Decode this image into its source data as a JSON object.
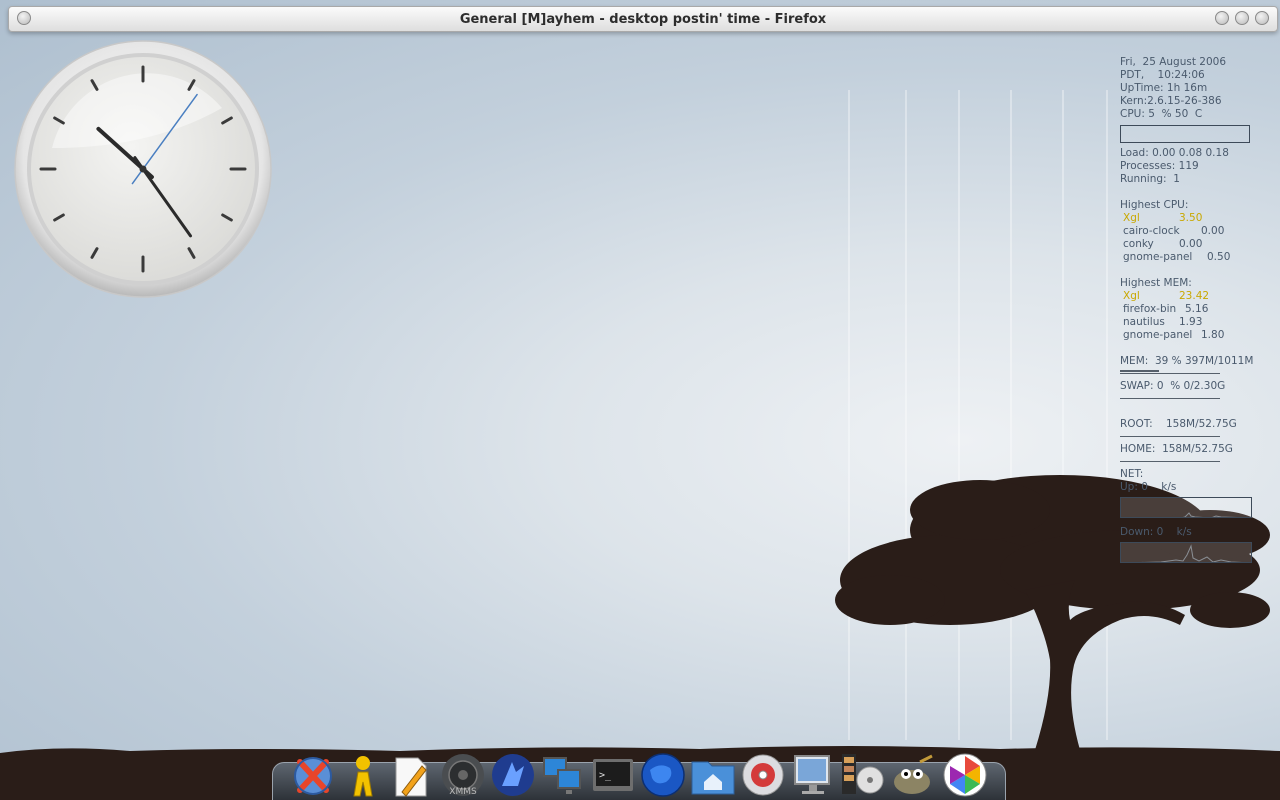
{
  "window": {
    "title": "General [M]ayhem - desktop postin' time - Firefox"
  },
  "conky": {
    "date": "Fri,  25 August 2006",
    "time": "PDT,    10:24:06",
    "uptime": "UpTime: 1h 16m",
    "kern": "Kern:2.6.15-26-386",
    "cpu": "CPU: 5  % 50  C",
    "load": "Load: 0.00 0.08 0.18",
    "processes": "Processes: 119",
    "running": "Running:  1",
    "highest_cpu_label": "Highest CPU:",
    "highest_cpu": [
      {
        "name": "Xgl",
        "value": "3.50"
      },
      {
        "name": "cairo-clock",
        "value": "0.00"
      },
      {
        "name": "conky",
        "value": "0.00"
      },
      {
        "name": "gnome-panel",
        "value": "0.50"
      }
    ],
    "highest_mem_label": "Highest MEM:",
    "highest_mem": [
      {
        "name": "Xgl",
        "value": "23.42"
      },
      {
        "name": "firefox-bin",
        "value": "5.16"
      },
      {
        "name": "nautilus",
        "value": "1.93"
      },
      {
        "name": "gnome-panel",
        "value": "1.80"
      }
    ],
    "mem": "MEM:  39 % 397M/1011M",
    "mem_fraction": 0.39,
    "swap": "SWAP: 0  % 0/2.30G",
    "swap_fraction": 0.0,
    "root": "ROOT:    158M/52.75G",
    "home": "HOME:  158M/52.75G",
    "net_label": "NET:",
    "up": "Up: 0    k/s",
    "down": "Down: 0    k/s"
  },
  "clock": {
    "hour": 10,
    "minute": 24,
    "second": 6
  },
  "dock": {
    "icons": [
      "crossover-icon",
      "messenger-icon",
      "text-editor-icon",
      "xmms-icon",
      "wolf-icon",
      "network-icon",
      "terminal-icon",
      "globe-icon",
      "home-folder-icon",
      "cd-burner-icon",
      "monitor-icon",
      "video-player-icon",
      "gimp-icon",
      "picasa-icon"
    ]
  },
  "colors": {
    "conky_text": "#4a5a6d",
    "conky_highlight": "#c9a800",
    "tree": "#2a1d18"
  }
}
